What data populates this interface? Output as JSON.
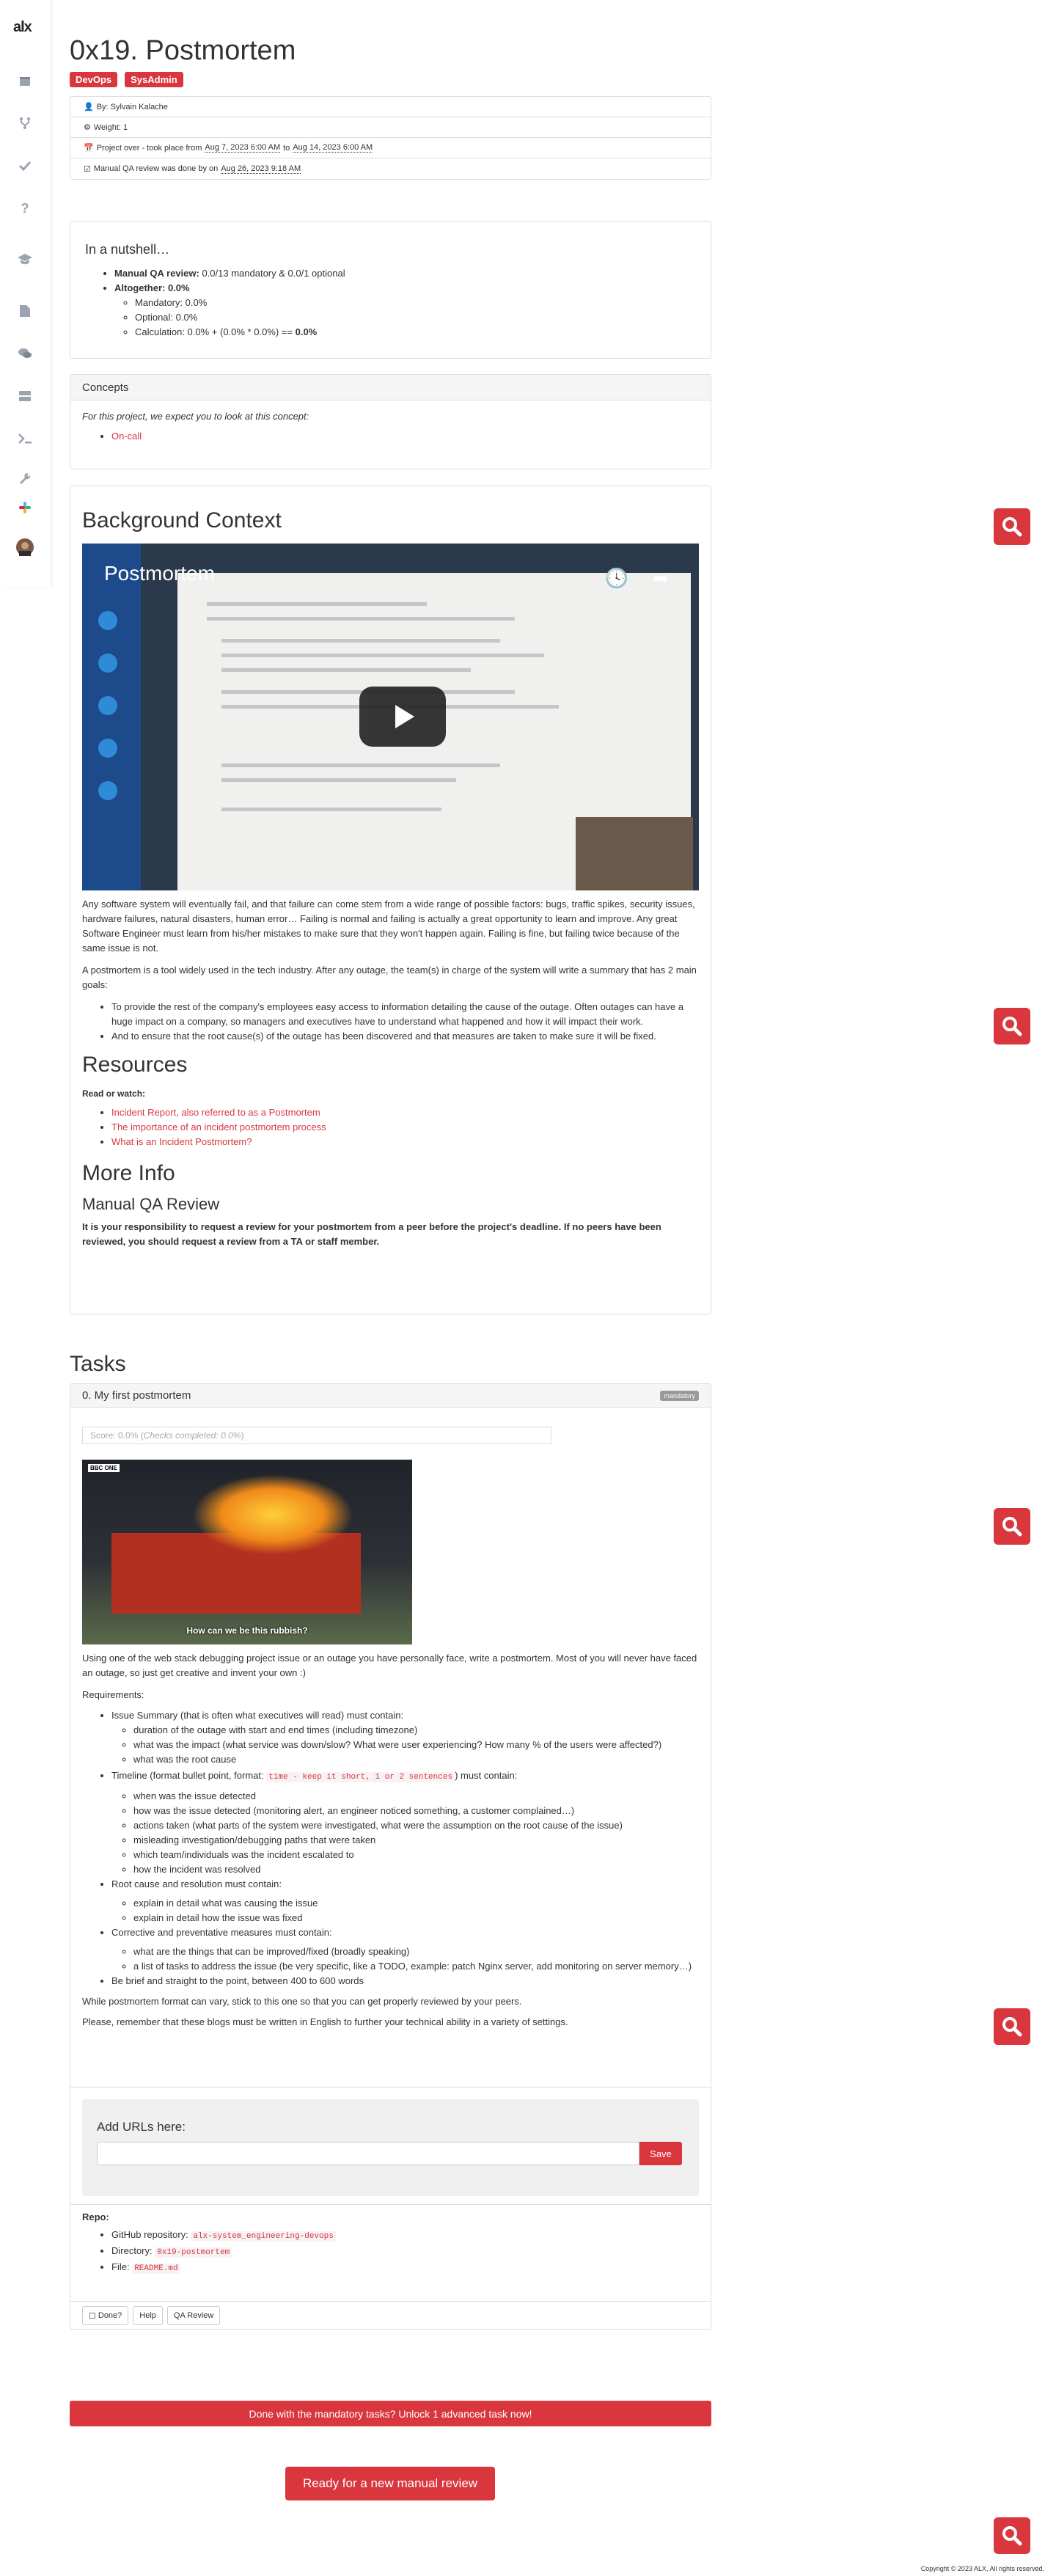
{
  "sidebar": {
    "logo": "alx",
    "icons": [
      "calendar-icon",
      "fork-icon",
      "check-icon",
      "question-icon",
      "graduation-cap-icon",
      "file-icon",
      "comments-icon",
      "server-icon",
      "terminal-icon",
      "wrench-icon",
      "slack-icon",
      "avatar"
    ]
  },
  "header": {
    "title": "0x19. Postmortem",
    "badges": [
      "DevOps",
      "SysAdmin"
    ]
  },
  "meta": {
    "by": "By: Sylvain Kalache",
    "weight": "Weight: 1",
    "project_prefix": "Project over - took place from",
    "start": "Aug 7, 2023 6:00 AM",
    "to": "to",
    "end": "Aug 14, 2023 6:00 AM",
    "qa_prefix": "Manual QA review was done by on",
    "qa_date": "Aug 26, 2023 9:18 AM"
  },
  "nutshell": {
    "title": "In a nutshell…",
    "qa_label": "Manual QA review:",
    "qa_value": "0.0/13 mandatory & 0.0/1 optional",
    "altogether_label": "Altogether:",
    "altogether_value": "0.0%",
    "mandatory": "Mandatory: 0.0%",
    "optional": "Optional: 0.0%",
    "calc": "Calculation: 0.0% + (0.0% * 0.0%) ==",
    "calc_result": "0.0%"
  },
  "concepts": {
    "title": "Concepts",
    "intro": "For this project, we expect you to look at this concept:",
    "items": [
      "On-call"
    ]
  },
  "background": {
    "title": "Background Context",
    "video_title": "Postmortem",
    "p1": "Any software system will eventually fail, and that failure can come stem from a wide range of possible factors: bugs, traffic spikes, security issues, hardware failures, natural disasters, human error… Failing is normal and failing is actually a great opportunity to learn and improve. Any great Software Engineer must learn from his/her mistakes to make sure that they won't happen again. Failing is fine, but failing twice because of the same issue is not.",
    "p2": "A postmortem is a tool widely used in the tech industry. After any outage, the team(s) in charge of the system will write a summary that has 2 main goals:",
    "goals": [
      "To provide the rest of the company's employees easy access to information detailing the cause of the outage. Often outages can have a huge impact on a company, so managers and executives have to understand what happened and how it will impact their work.",
      "And to ensure that the root cause(s) of the outage has been discovered and that measures are taken to make sure it will be fixed."
    ]
  },
  "resources": {
    "title": "Resources",
    "read": "Read or watch:",
    "links": [
      "Incident Report, also referred to as a Postmortem",
      "The importance of an incident postmortem process",
      "What is an Incident Postmortem?"
    ]
  },
  "more": {
    "title": "More Info",
    "qa_title": "Manual QA Review",
    "qa_text": "It is your responsibility to request a review for your postmortem from a peer before the project's deadline. If no peers have been reviewed, you should request a review from a TA or staff member."
  },
  "tasks": {
    "title": "Tasks",
    "task0": {
      "name": "0. My first postmortem",
      "badge": "mandatory",
      "score_prefix": "Score: 0.0% (",
      "score_italic": "Checks completed: 0.0%",
      "score_suffix": ")",
      "gif_caption": "How can we be this rubbish?",
      "gif_logo": "BBC ONE",
      "intro": "Using one of the web stack debugging project issue or an outage you have personally face, write a postmortem. Most of you will never have faced an outage, so just get creative and invent your own :)",
      "req": "Requirements:",
      "issue": "Issue Summary (that is often what executives will read) must contain:",
      "issue_items": [
        "duration of the outage with start and end times (including timezone)",
        "what was the impact (what service was down/slow? What were user experiencing? How many % of the users were affected?)",
        "what was the root cause"
      ],
      "timeline_a": "Timeline (format bullet point, format:",
      "timeline_code": "time - keep it short, 1 or 2 sentences",
      "timeline_b": ") must contain:",
      "timeline_items": [
        "when was the issue detected",
        "how was the issue detected (monitoring alert, an engineer noticed something, a customer complained…)",
        "actions taken (what parts of the system were investigated, what were the assumption on the root cause of the issue)",
        "misleading investigation/debugging paths that were taken",
        "which team/individuals was the incident escalated to",
        "how the incident was resolved"
      ],
      "root": "Root cause and resolution must contain:",
      "root_items": [
        "explain in detail what was causing the issue",
        "explain in detail how the issue was fixed"
      ],
      "corrective": "Corrective and preventative measures must contain:",
      "corrective_items": [
        "what are the things that can be improved/fixed (broadly speaking)",
        "a list of tasks to address the issue (be very specific, like a TODO, example: patch Nginx server, add monitoring on server memory…)"
      ],
      "brief": "Be brief and straight to the point, between 400 to 600 words",
      "p_format": "While postmortem format can vary, stick to this one so that you can get properly reviewed by your peers.",
      "p_english": "Please, remember that these blogs must be written in English to further your technical ability in a variety of settings.",
      "urls_title": "Add URLs here:",
      "save": "Save",
      "repo_title": "Repo:",
      "repo_label": "GitHub repository:",
      "repo": "alx-system_engineering-devops",
      "dir_label": "Directory:",
      "dir": "0x19-postmortem",
      "file_label": "File:",
      "file": "README.md",
      "done": "Done?",
      "help": "Help",
      "qa": "QA Review"
    }
  },
  "footer": {
    "advanced": "Done with the mandatory tasks? Unlock 1 advanced task now!",
    "review": "Ready for a new manual review",
    "copyright": "Copyright © 2023 ALX, All rights reserved."
  },
  "colors": {
    "accent": "#d9363e"
  }
}
